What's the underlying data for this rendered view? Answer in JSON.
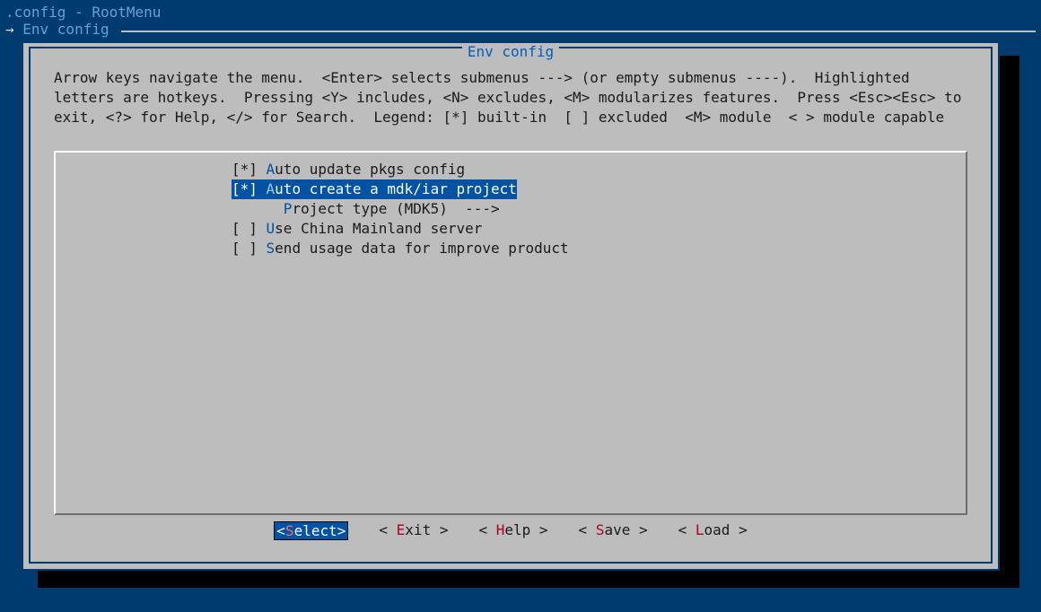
{
  "header": {
    "title": ".config - RootMenu",
    "breadcrumb_arrow": "→ ",
    "breadcrumb": "Env config"
  },
  "dialog": {
    "title": " Env config ",
    "help_text": "Arrow keys navigate the menu.  <Enter> selects submenus ---> (or empty submenus ----).  Highlighted letters are hotkeys.  Pressing <Y> includes, <N> excludes, <M> modularizes features.  Press <Esc><Esc> to exit, <?> for Help, </> for Search.  Legend: [*] built-in  [ ] excluded  <M> module  < > module capable"
  },
  "menu": {
    "items": [
      {
        "prefix": "[*] ",
        "hotkey": "A",
        "rest": "uto update pkgs config",
        "selected": false,
        "indent": ""
      },
      {
        "prefix": "[*] ",
        "hotkey": "A",
        "rest": "uto create a mdk/iar project",
        "selected": true,
        "indent": ""
      },
      {
        "prefix": "      ",
        "hotkey": "P",
        "rest": "roject type (MDK5)  --->",
        "selected": false,
        "indent": ""
      },
      {
        "prefix": "[ ] ",
        "hotkey": "U",
        "rest": "se China Mainland server",
        "selected": false,
        "indent": ""
      },
      {
        "prefix": "[ ] ",
        "hotkey": "S",
        "rest": "end usage data for improve product",
        "selected": false,
        "indent": ""
      }
    ]
  },
  "buttons": [
    {
      "left": "<",
      "hotkey": "S",
      "rest": "elect",
      "right": ">",
      "selected": true
    },
    {
      "left": "< ",
      "hotkey": "E",
      "rest": "xit ",
      "right": ">",
      "selected": false
    },
    {
      "left": "< ",
      "hotkey": "H",
      "rest": "elp ",
      "right": ">",
      "selected": false
    },
    {
      "left": "< ",
      "hotkey": "S",
      "rest": "ave ",
      "right": ">",
      "selected": false
    },
    {
      "left": "< ",
      "hotkey": "L",
      "rest": "oad ",
      "right": ">",
      "selected": false
    }
  ]
}
